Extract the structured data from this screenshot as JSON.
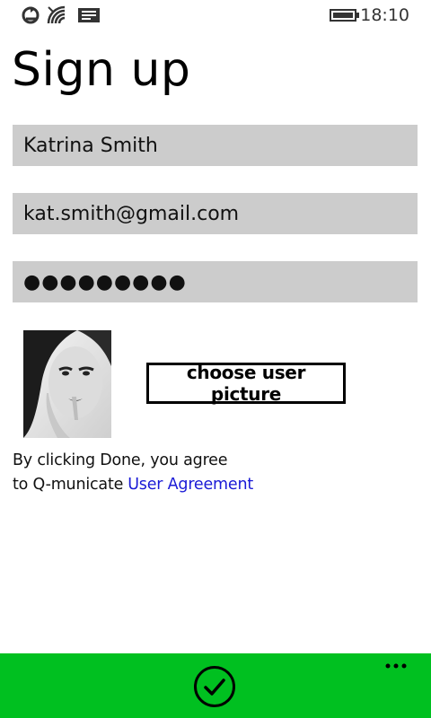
{
  "status_bar": {
    "time": "18:10",
    "icons": [
      "sync-icon",
      "signal-icon",
      "message-icon",
      "battery-icon"
    ]
  },
  "page": {
    "title": "Sign up"
  },
  "form": {
    "name_value": "Katrina Smith",
    "email_value": "kat.smith@gmail.com",
    "password_value": "●●●●●●●●●"
  },
  "avatar": {
    "choose_label": "choose user picture"
  },
  "agreement": {
    "line1": "By clicking Done, you agree",
    "line2": "to Q-municate",
    "link": "User Agreement"
  },
  "app_bar": {
    "done_icon": "check-circle-icon",
    "more_icon": "ellipsis-icon"
  },
  "colors": {
    "app_bar": "#00c020",
    "field_bg": "#cccccc",
    "link": "#1a1ad6"
  }
}
